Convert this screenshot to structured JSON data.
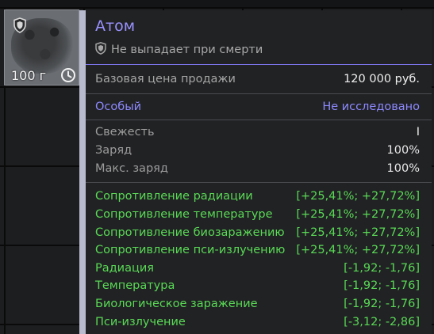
{
  "item": {
    "weight": "100 г"
  },
  "tooltip": {
    "title": "Атом",
    "drop_status": "Не выпадает при смерти",
    "price": {
      "label": "Базовая цена продажи",
      "value": "120 000 руб."
    },
    "status": {
      "label": "Особый",
      "value": "Не исследовано"
    },
    "stats": [
      {
        "label": "Свежесть",
        "value": "I"
      },
      {
        "label": "Заряд",
        "value": "100%"
      },
      {
        "label": "Макс. заряд",
        "value": "100%"
      }
    ],
    "effects": [
      {
        "label": "Сопротивление радиации",
        "value": "[+25,41%; +27,72%]"
      },
      {
        "label": "Сопротивление температуре",
        "value": "[+25,41%; +27,72%]"
      },
      {
        "label": "Сопротивление биозаражению",
        "value": "[+25,41%; +27,72%]"
      },
      {
        "label": "Сопротивление пси-излучению",
        "value": "[+25,41%; +27,72%]"
      },
      {
        "label": "Радиация",
        "value": "[-1,92; -1,76]"
      },
      {
        "label": "Температура",
        "value": "[-1,92; -1,76]"
      },
      {
        "label": "Биологическое заражение",
        "value": "[-1,92; -1,76]"
      },
      {
        "label": "Пси-излучение",
        "value": "[-3,12; -2,86]"
      }
    ]
  },
  "colors": {
    "title": "#9a92ff",
    "status": "#8d89ff",
    "effect": "#59d955",
    "accent_line": "#7a73e8"
  },
  "icons": {
    "slot_badge": "shield-icon",
    "slot_timer": "clock-icon",
    "drop_badge": "shield-icon"
  }
}
